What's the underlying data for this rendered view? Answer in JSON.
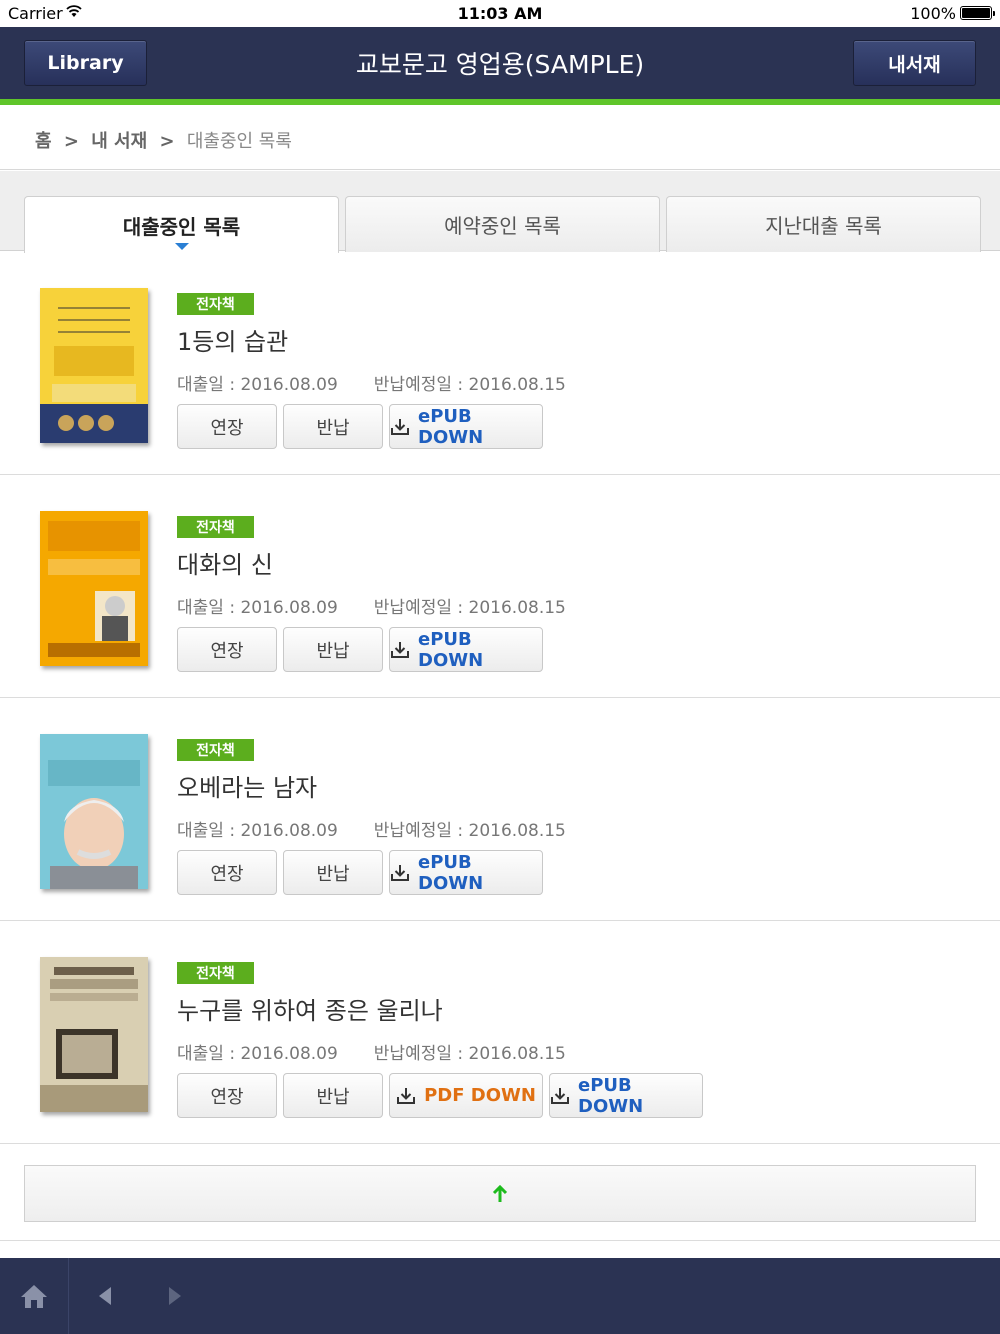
{
  "status_bar": {
    "carrier": "Carrier",
    "time": "11:03 AM",
    "battery": "100%"
  },
  "header": {
    "left_button": "Library",
    "title": "교보문고 영업용(SAMPLE)",
    "right_button": "내서재"
  },
  "breadcrumb": {
    "home": "홈",
    "sep1": ">",
    "my_library": "내 서재",
    "sep2": ">",
    "current": "대출중인 목록"
  },
  "tabs": [
    {
      "label": "대출중인 목록",
      "active": true
    },
    {
      "label": "예약중인 목록",
      "active": false
    },
    {
      "label": "지난대출 목록",
      "active": false
    }
  ],
  "labels": {
    "badge": "전자책",
    "extend": "연장",
    "return": "반납",
    "epub_down": "ePUB DOWN",
    "pdf_down": "PDF DOWN"
  },
  "books": [
    {
      "title": "1등의 습관",
      "loan_date": "대출일 : 2016.08.09",
      "due_date": "반납예정일 : 2016.08.15",
      "cover_color": "#f7d23a"
    },
    {
      "title": "대화의 신",
      "loan_date": "대출일 : 2016.08.09",
      "due_date": "반납예정일 : 2016.08.15",
      "cover_color": "#f5a800"
    },
    {
      "title": "오베라는 남자",
      "loan_date": "대출일 : 2016.08.09",
      "due_date": "반납예정일 : 2016.08.15",
      "cover_color": "#7cc8d8"
    },
    {
      "title": "누구를 위하여 종은 울리나",
      "loan_date": "대출일 : 2016.08.09",
      "due_date": "반납예정일 : 2016.08.15",
      "cover_color": "#d9cfb2"
    }
  ],
  "colors": {
    "navbar": "#2b3353",
    "accent_green": "#5fc52a",
    "badge_green": "#5cae1e",
    "epub_blue": "#1f5fbf",
    "pdf_orange": "#e07012"
  },
  "icons": {
    "top": "up-arrow-icon",
    "home": "home-icon",
    "back": "back-arrow-icon",
    "forward": "forward-arrow-icon"
  }
}
